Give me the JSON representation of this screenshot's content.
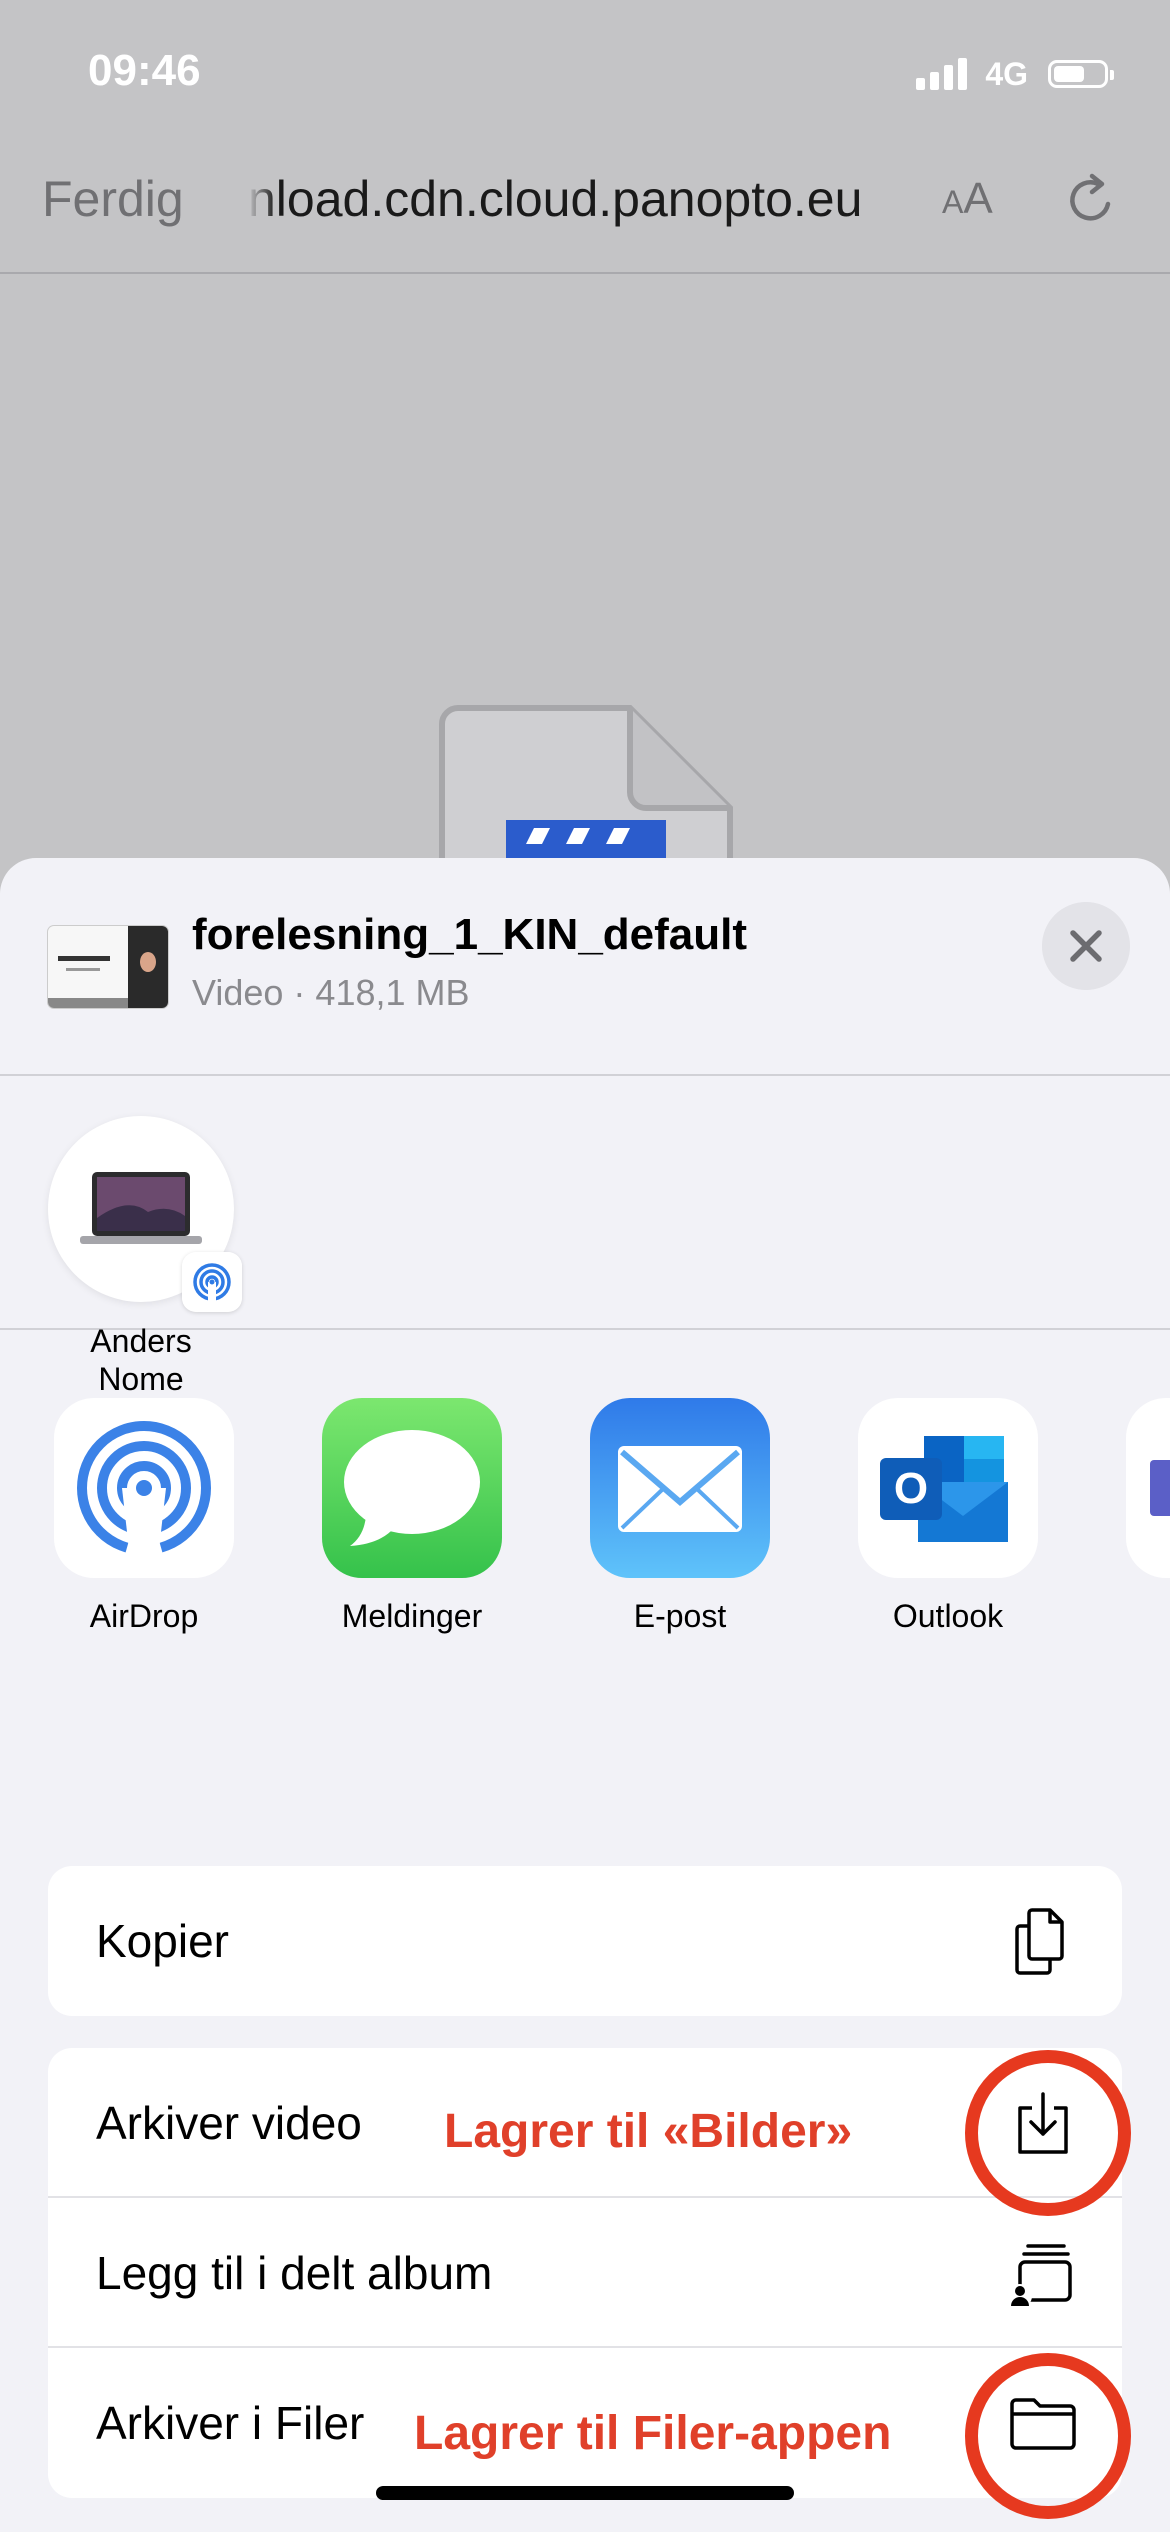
{
  "status_bar": {
    "time": "09:46",
    "network": "4G",
    "battery_level": 0.62
  },
  "nav": {
    "done_label": "Ferdig",
    "url": "nload.cdn.cloud.panopto.eu",
    "text_size_small": "A",
    "text_size_large": "A"
  },
  "share_sheet": {
    "file_name": "forelesning_1_KIN_default",
    "file_meta": "Video · 418,1 MB",
    "thumbnail_text": "Forelesning 1",
    "airdrop_people": [
      {
        "name": "Anders Nome"
      }
    ],
    "apps": [
      {
        "label": "AirDrop",
        "icon": "airdrop-icon"
      },
      {
        "label": "Meldinger",
        "icon": "messages-icon"
      },
      {
        "label": "E-post",
        "icon": "mail-icon"
      },
      {
        "label": "Outlook",
        "icon": "outlook-icon"
      }
    ],
    "actions_group1": [
      {
        "label": "Kopier",
        "icon": "copy-icon"
      }
    ],
    "actions_group2": [
      {
        "label": "Arkiver video",
        "icon": "save-download-icon"
      },
      {
        "label": "Legg til i delt album",
        "icon": "shared-album-icon"
      },
      {
        "label": "Arkiver i Filer",
        "icon": "folder-icon"
      }
    ]
  },
  "annotations": {
    "save_video_note": "Lagrer til «Bilder»",
    "save_files_note": "Lagrer til Filer-appen",
    "ring_color": "#e6391f",
    "text_color": "#e0402a"
  }
}
